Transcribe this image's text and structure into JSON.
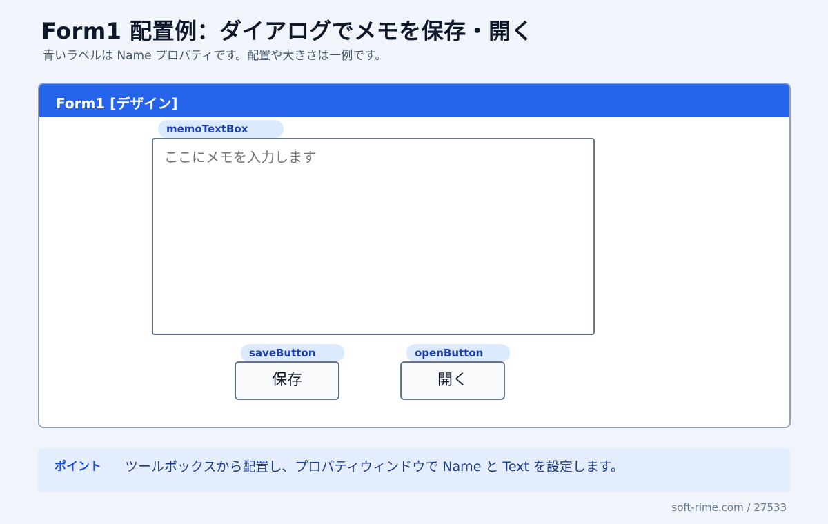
{
  "page": {
    "title": "Form1 配置例：ダイアログでメモを保存・開く",
    "subtitle": "青いラベルは Name プロパティです。配置や大きさは一例です。"
  },
  "form": {
    "title": "Form1 [デザイン]",
    "memo_textbox": {
      "name": "memoTextBox",
      "placeholder": "ここにメモを入力します"
    },
    "save_button": {
      "name": "saveButton",
      "label": "保存"
    },
    "open_button": {
      "name": "openButton",
      "label": "開く"
    }
  },
  "tip": {
    "label": "ポイント",
    "text": "ツールボックスから配置し、プロパティウィンドウで Name と Text を設定します。"
  },
  "footer": {
    "credit": "soft-rime.com / 27533"
  },
  "colors": {
    "titlebar": "#2563eb",
    "name_label_bg": "#dbeafe",
    "name_label_text": "#1e40af",
    "tip_bg": "#e3edfc",
    "page_bg": "#f1f5fb"
  }
}
